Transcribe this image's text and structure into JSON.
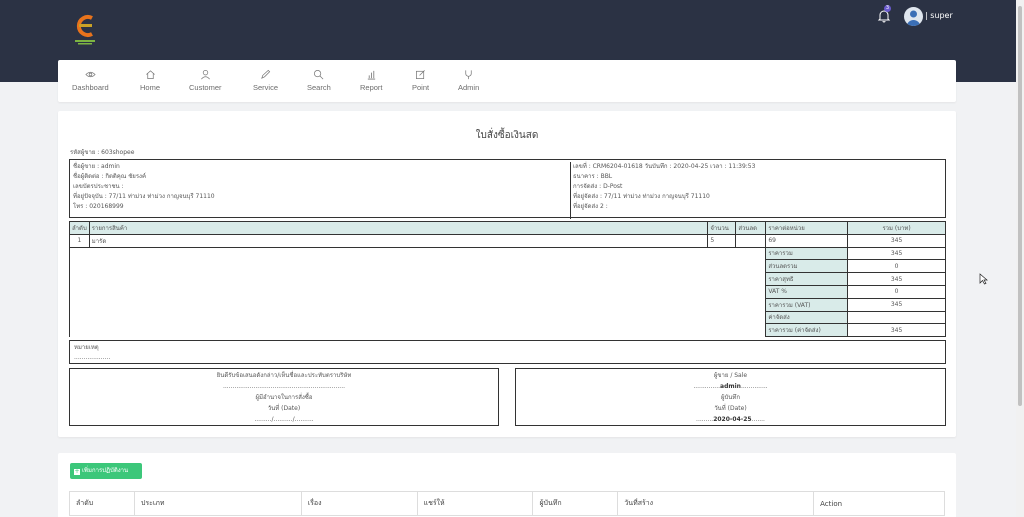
{
  "app": {
    "colors": {
      "topbar": "#2b3244",
      "accent": "#3cc77a",
      "header_cell": "#d9ebe9"
    }
  },
  "header": {
    "username": "| super",
    "notification_count": "3"
  },
  "nav": {
    "items": [
      {
        "label": "Dashboard",
        "icon": "eye-icon"
      },
      {
        "label": "Home",
        "icon": "home-icon"
      },
      {
        "label": "Customer",
        "icon": "user-icon"
      },
      {
        "label": "Service",
        "icon": "pen-icon"
      },
      {
        "label": "Search",
        "icon": "search-icon"
      },
      {
        "label": "Report",
        "icon": "bar-chart-icon"
      },
      {
        "label": "Point",
        "icon": "edit-icon"
      },
      {
        "label": "Admin",
        "icon": "admin-icon"
      }
    ]
  },
  "document": {
    "title": "ใบสั่งซื้อเงินสด",
    "seller_code": "รหัสผู้ขาย : 603shopee",
    "left": {
      "seller": "ชื่อผู้ขาย : admin",
      "contact": "ชื่อผู้ติดต่อ :    กิตติคุณ ชัยรงค์",
      "id_card": "เลขบัตรประชาชน :",
      "address": "ที่อยู่ปัจจุบัน : 77/11 ท่าม่วง ท่าม่วง กาญจนบุรี 71110",
      "phone": "โทร :  020168999"
    },
    "right": {
      "number": "เลขที่ : CRM6204-01618   วันบันทึก : 2020-04-25 เวลา : 11:39:53",
      "bank": "ธนาคาร : BBL",
      "shipping": "การจัดส่ง : D-Post",
      "ship_addr1": "ที่อยู่จัดส่ง : 77/11 ท่าม่วง ท่าม่วง กาญจนบุรี 71110",
      "ship_addr2": "ที่อยู่จัดส่ง 2 :"
    },
    "table": {
      "headers": {
        "no": "ลำดับ",
        "item": "รายการสินค้า",
        "qty": "จำนวน",
        "discount": "ส่วนลด",
        "unit_price": "ราคาต่อหน่วย",
        "total": "รวม (บาท)"
      },
      "row": {
        "no": "1",
        "item": "มารัด",
        "qty": "5",
        "discount": "",
        "unit_price": "69",
        "total": "345"
      },
      "summary": [
        {
          "label": "ราคารวม",
          "value": "345"
        },
        {
          "label": "ส่วนลดรวม",
          "value": "0"
        },
        {
          "label": "ราคาสุทธิ",
          "value": "345"
        },
        {
          "label": "VAT %",
          "value": "0"
        },
        {
          "label": "ราคารวม (VAT)",
          "value": "345"
        },
        {
          "label": "ค่าจัดส่ง",
          "value": ""
        },
        {
          "label": "ราคารวม (ค่าจัดส่ง)",
          "value": "345"
        }
      ]
    },
    "note": {
      "label": "หมายเหตุ",
      "line": "..................."
    },
    "sign_left": {
      "statement": "ยินดีรับข้อเสนอดังกล่าว/เห็นชื่อและประทับตราบริษัท",
      "line": "................................................................",
      "role": "ผู้มีอำนาจในการสั่งซื้อ",
      "date_label": "วันที่ (Date)",
      "date_line": "........./........../.........."
    },
    "sign_right": {
      "title": "ผู้ขาย / Sale",
      "name": "admin",
      "role": "ผู้บันทึก",
      "date_label": "วันที่ (Date)",
      "date": "2020-04-25"
    }
  },
  "history": {
    "add_button": "เพิ่มการปฏิบัติงาน",
    "columns": [
      "ลำดับ",
      "ประเภท",
      "เรื่อง",
      "แชร์ให้",
      "ผู้บันทึก",
      "วันที่สร้าง",
      "Action"
    ]
  }
}
